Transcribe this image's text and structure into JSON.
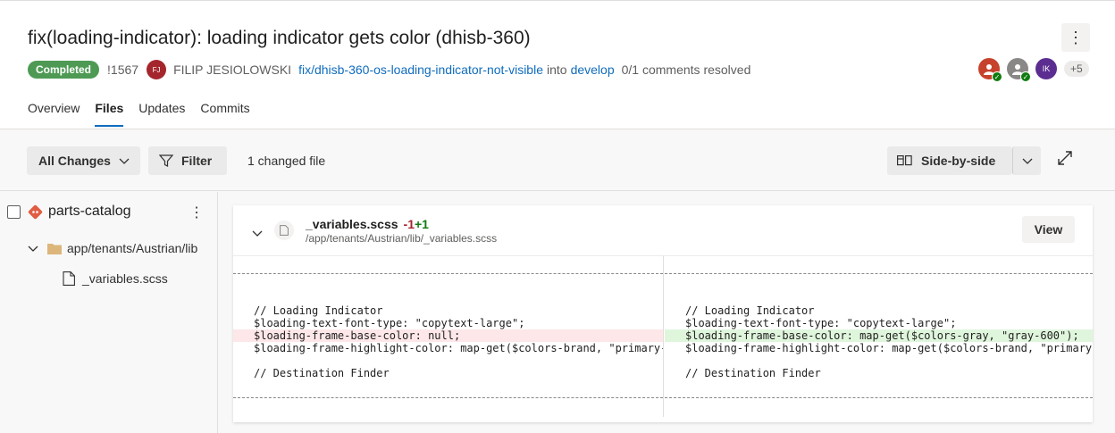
{
  "pr": {
    "title": "fix(loading-indicator): loading indicator gets color (dhisb-360)",
    "status": "Completed",
    "id": "!1567",
    "author_initials": "FJ",
    "author": "FILIP JESIOLOWSKI",
    "source_branch": "fix/dhisb-360-os-loading-indicator-not-visible",
    "into": "into",
    "target_branch": "develop",
    "comments": "0/1 comments resolved",
    "more_menu_icon": "⋮"
  },
  "reviewers": {
    "r3_initials": "IK",
    "more_count": "+5"
  },
  "tabs": [
    "Overview",
    "Files",
    "Updates",
    "Commits"
  ],
  "toolbar": {
    "all_changes": "All Changes",
    "filter": "Filter",
    "changed_count": "1 changed file",
    "view_mode": "Side-by-side"
  },
  "tree": {
    "repo": "parts-catalog",
    "folder": "app/tenants/Austrian/lib",
    "file": "_variables.scss"
  },
  "diff": {
    "filename": "_variables.scss",
    "removed": "-1",
    "added": "+1",
    "path": "/app/tenants/Austrian/lib/_variables.scss",
    "view_label": "View",
    "left_lines": [
      "// Loading Indicator",
      "$loading-text-font-type: \"copytext-large\";",
      "$loading-frame-base-color: null;",
      "$loading-frame-highlight-color: map-get($colors-brand, \"primary-",
      "",
      "// Destination Finder"
    ],
    "right_lines": [
      "// Loading Indicator",
      "$loading-text-font-type: \"copytext-large\";",
      "$loading-frame-base-color: map-get($colors-gray, \"gray-600\");",
      "$loading-frame-highlight-color: map-get($colors-brand, \"primary",
      "",
      "// Destination Finder"
    ]
  },
  "colors": {
    "accent": "#0f6cbd",
    "completed": "#4e9a54",
    "deleted_bg": "#fde7e9",
    "added_bg": "#dff6dd"
  }
}
